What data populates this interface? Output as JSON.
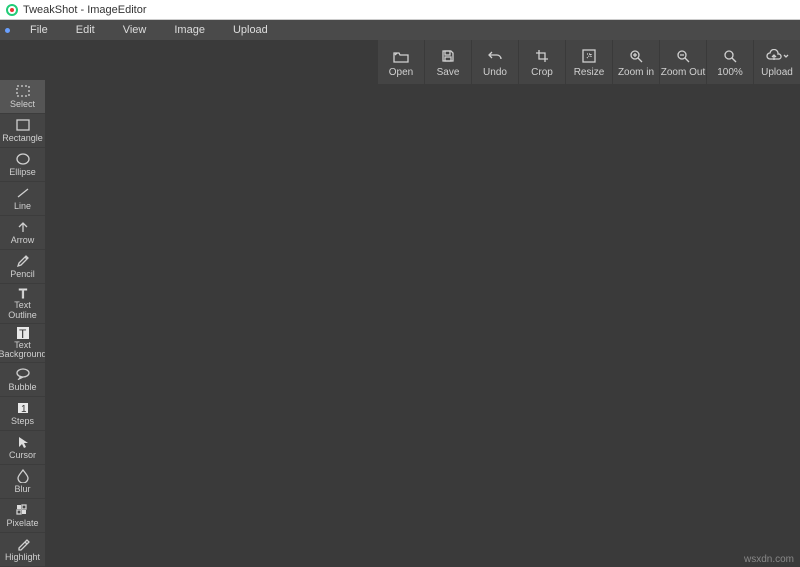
{
  "title": "TweakShot - ImageEditor",
  "menu": {
    "items": [
      "File",
      "Edit",
      "View",
      "Image",
      "Upload"
    ]
  },
  "topbar": {
    "items": [
      {
        "id": "open",
        "label": "Open"
      },
      {
        "id": "save",
        "label": "Save"
      },
      {
        "id": "undo",
        "label": "Undo"
      },
      {
        "id": "crop",
        "label": "Crop"
      },
      {
        "id": "resize",
        "label": "Resize"
      },
      {
        "id": "zoomin",
        "label": "Zoom in"
      },
      {
        "id": "zoomout",
        "label": "Zoom Out"
      },
      {
        "id": "zoom100",
        "label": "100%"
      },
      {
        "id": "upload",
        "label": "Upload"
      }
    ]
  },
  "sidebar": {
    "items": [
      {
        "id": "select",
        "label": "Select",
        "selected": true
      },
      {
        "id": "rectangle",
        "label": "Rectangle"
      },
      {
        "id": "ellipse",
        "label": "Ellipse"
      },
      {
        "id": "line",
        "label": "Line"
      },
      {
        "id": "arrow",
        "label": "Arrow"
      },
      {
        "id": "pencil",
        "label": "Pencil"
      },
      {
        "id": "text-outline",
        "label": "Text\nOutline"
      },
      {
        "id": "text-background",
        "label": "Text\nBackground"
      },
      {
        "id": "bubble",
        "label": "Bubble"
      },
      {
        "id": "steps",
        "label": "Steps"
      },
      {
        "id": "cursor",
        "label": "Cursor"
      },
      {
        "id": "blur",
        "label": "Blur"
      },
      {
        "id": "pixelate",
        "label": "Pixelate"
      },
      {
        "id": "highlight",
        "label": "Highlight"
      }
    ]
  },
  "watermark": "wsxdn.com"
}
